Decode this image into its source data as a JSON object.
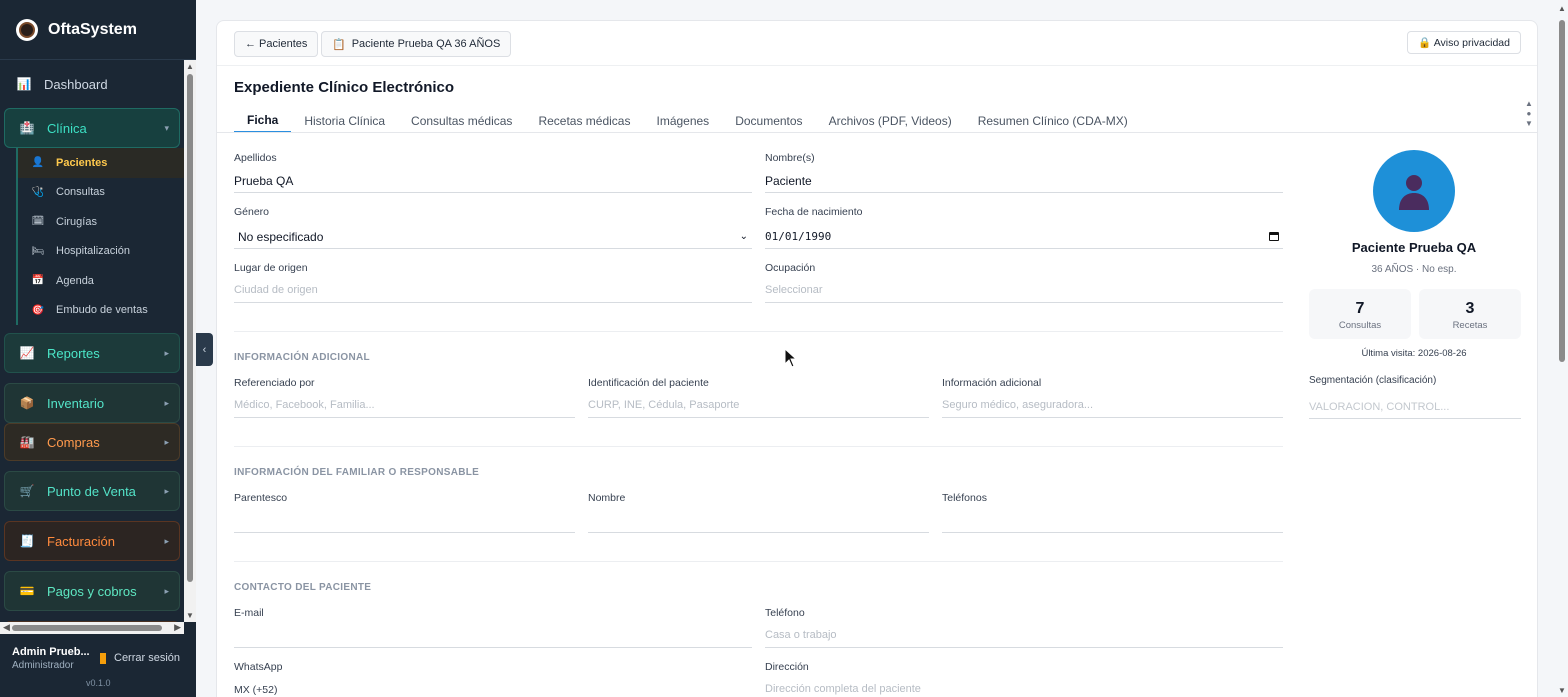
{
  "brand": {
    "name": "OftaSystem"
  },
  "sidebar": {
    "dashboard": "Dashboard",
    "clinica": {
      "label": "Clínica",
      "items": [
        "Pacientes",
        "Consultas",
        "Cirugías",
        "Hospitalización",
        "Agenda",
        "Embudo de ventas"
      ]
    },
    "groups": [
      "Reportes",
      "Inventario",
      "Compras",
      "Punto de Venta",
      "Facturación",
      "Pagos y cobros"
    ]
  },
  "user": {
    "name": "Admin Prueb...",
    "role": "Administrador",
    "logout": "Cerrar sesión",
    "version": "v0.1.0"
  },
  "topbar": {
    "back": "← Pacientes",
    "patient_chip": "Paciente Prueba QA 36 AÑOS",
    "privacy": "🔒 Aviso privacidad"
  },
  "expediente": {
    "title": "Expediente Clínico Electrónico",
    "tabs": [
      "Ficha",
      "Historia Clínica",
      "Consultas médicas",
      "Recetas médicas",
      "Imágenes",
      "Documentos",
      "Archivos (PDF, Videos)",
      "Resumen Clínico (CDA-MX)"
    ],
    "active_tab": "Ficha"
  },
  "ficha": {
    "apellidos": {
      "label": "Apellidos",
      "value": "Prueba QA"
    },
    "nombres": {
      "label": "Nombre(s)",
      "value": "Paciente"
    },
    "genero": {
      "label": "Género",
      "value": "No especificado"
    },
    "nacimiento": {
      "label": "Fecha de nacimiento",
      "value": "01/01/1990"
    },
    "origen": {
      "label": "Lugar de origen",
      "placeholder": "Ciudad de origen"
    },
    "ocupacion": {
      "label": "Ocupación",
      "placeholder": "Seleccionar"
    }
  },
  "adicional": {
    "section": "INFORMACIÓN ADICIONAL",
    "referenciado": {
      "label": "Referenciado por",
      "placeholder": "Médico, Facebook, Familia..."
    },
    "identificacion": {
      "label": "Identificación del paciente",
      "placeholder": "CURP, INE, Cédula, Pasaporte"
    },
    "info": {
      "label": "Información adicional",
      "placeholder": "Seguro médico, aseguradora..."
    }
  },
  "familiar": {
    "section": "INFORMACIÓN DEL FAMILIAR O RESPONSABLE",
    "parentesco": "Parentesco",
    "nombre": "Nombre",
    "telefonos": "Teléfonos"
  },
  "contacto": {
    "section": "CONTACTO DEL PACIENTE",
    "email": {
      "label": "E-mail"
    },
    "telefono": {
      "label": "Teléfono",
      "placeholder": "Casa o trabajo"
    },
    "whatsapp": {
      "label": "WhatsApp",
      "value": "MX (+52)"
    },
    "direccion": {
      "label": "Dirección",
      "placeholder": "Dirección completa del paciente"
    }
  },
  "profile": {
    "name": "Paciente Prueba QA",
    "meta": "36 AÑOS · No esp.",
    "consultas_count": "7",
    "consultas_label": "Consultas",
    "recetas_count": "3",
    "recetas_label": "Recetas",
    "last_visit": "Última visita: 2026-08-26",
    "segmentacion_label": "Segmentación (clasificación)",
    "segmentacion_placeholder": "VALORACION, CONTROL..."
  },
  "colors": {
    "accent": "#2b8fe0",
    "sidebar_bg": "#1b2734",
    "active_sub": "#ffc94d"
  }
}
